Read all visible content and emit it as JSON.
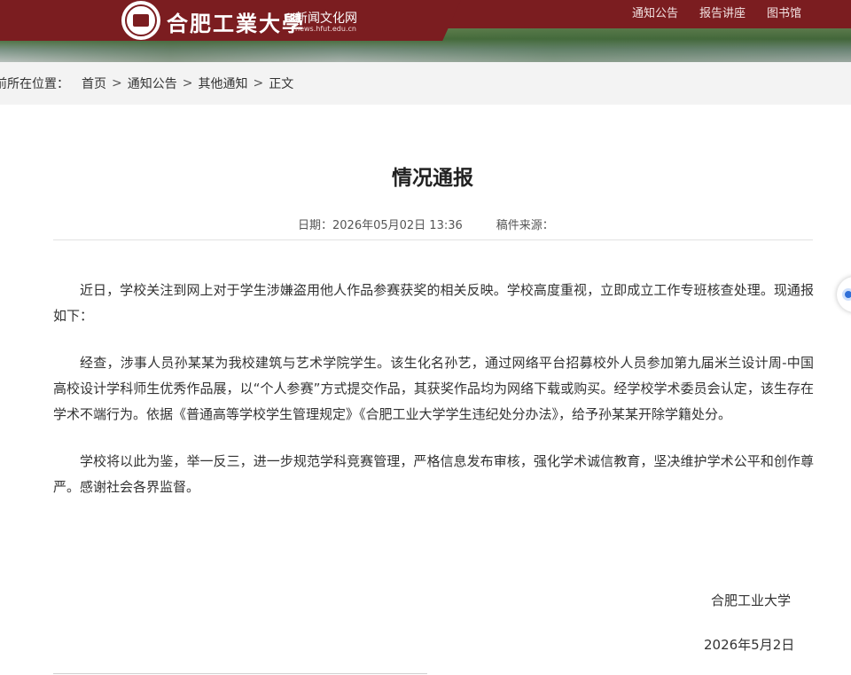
{
  "header": {
    "logo_name": "合肥工業大學",
    "logo_subtitle": "新闻文化网",
    "logo_url": "news.hfut.edu.cn",
    "nav": [
      "通知公告",
      "报告讲座",
      "图书馆"
    ]
  },
  "breadcrumb": {
    "label": "前所在位置：",
    "items": [
      "首页",
      "通知公告",
      "其他通知",
      "正文"
    ],
    "separator": ">"
  },
  "article": {
    "title": "情况通报",
    "date_label": "日期：2026年05月02日 13:36",
    "source_label": "稿件来源：",
    "paragraphs": [
      "近日，学校关注到网上对于学生涉嫌盗用他人作品参赛获奖的相关反映。学校高度重视，立即成立工作专班核查处理。现通报如下：",
      "经查，涉事人员孙某某为我校建筑与艺术学院学生。该生化名孙艺，通过网络平台招募校外人员参加第九届米兰设计周-中国高校设计学科师生优秀作品展，以“个人参赛”方式提交作品，其获奖作品均为网络下载或购买。经学校学术委员会认定，该生存在学术不端行为。依据《普通高等学校学生管理规定》《合肥工业大学学生违纪处分办法》，给予孙某某开除学籍处分。",
      "学校将以此为鉴，举一反三，进一步规范学科竞赛管理，严格信息发布审核，强化学术诚信教育，坚决维护学术公平和创作尊严。感谢社会各界监督。"
    ],
    "signature_org": "合肥工业大学",
    "signature_date": "2026年5月2日"
  },
  "colors": {
    "brand": "#7b1d20",
    "breadcrumb_bg": "#f3f3f3",
    "float_accent": "#2f6fd8"
  }
}
